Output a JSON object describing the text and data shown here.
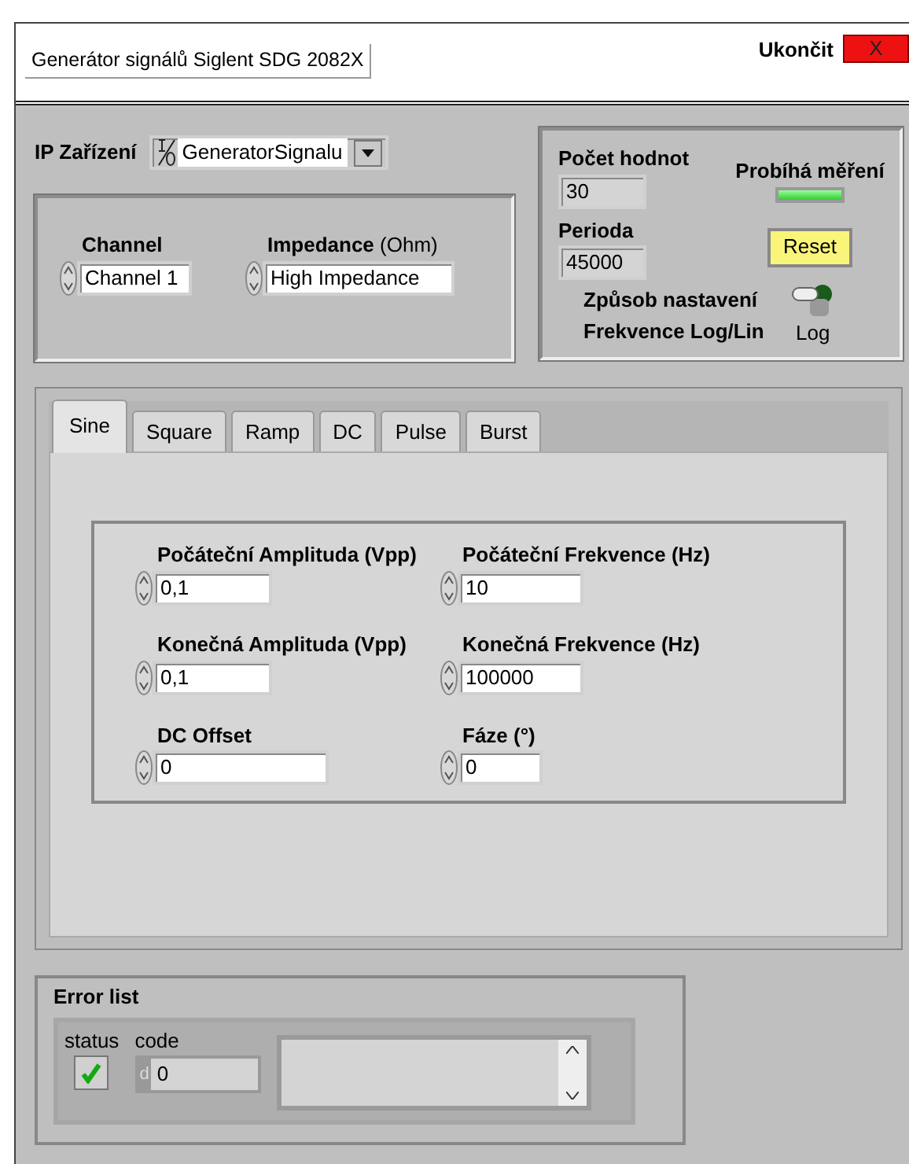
{
  "window": {
    "title": "Generátor signálů Siglent SDG 2082X"
  },
  "exit": {
    "label": "Ukončit",
    "button": "X"
  },
  "ip_device": {
    "label": "IP Zařízení",
    "value": "GeneratorSignalu"
  },
  "channel": {
    "label": "Channel",
    "value": "Channel 1"
  },
  "impedance": {
    "label": "Impedance",
    "unit": "(Ohm)",
    "value": "High Impedance"
  },
  "count": {
    "label": "Počet hodnot",
    "value": "30"
  },
  "period": {
    "label": "Perioda",
    "value": "45000"
  },
  "measuring": {
    "label": "Probíhá měření",
    "on": true
  },
  "reset": {
    "label": "Reset"
  },
  "freq_mode": {
    "label_lines": [
      "Způsob nastavení",
      "Frekvence Log/Lin"
    ],
    "value": "Log",
    "on": false
  },
  "tabs": [
    {
      "label": "Sine",
      "selected": true
    },
    {
      "label": "Square",
      "selected": false
    },
    {
      "label": "Ramp",
      "selected": false
    },
    {
      "label": "DC",
      "selected": false
    },
    {
      "label": "Pulse",
      "selected": false
    },
    {
      "label": "Burst",
      "selected": false
    }
  ],
  "fields": [
    {
      "label": "Počáteční Amplituda (Vpp)",
      "value": "0,1"
    },
    {
      "label": "Počáteční Frekvence (Hz)",
      "value": "10"
    },
    {
      "label": "Konečná Amplituda (Vpp)",
      "value": "0,1"
    },
    {
      "label": "Konečná Frekvence (Hz)",
      "value": "100000"
    },
    {
      "label": "DC Offset",
      "value": "0"
    },
    {
      "label": "Fáze (°)",
      "value": "0"
    }
  ],
  "error": {
    "title": "Error list",
    "status_label": "status",
    "status_ok": true,
    "code_label": "code",
    "radix": "d",
    "code": "0"
  }
}
